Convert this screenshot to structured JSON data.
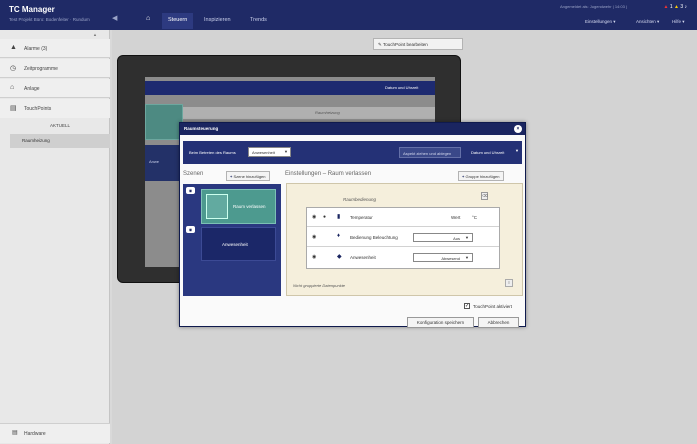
{
  "app": {
    "title": "TC Manager",
    "subtitle": "Test Projekt Büro: Bodenfeiter · Rundum"
  },
  "nav": {
    "tabs": [
      "Steuern",
      "Inspizieren",
      "Trends"
    ],
    "active": "Steuern"
  },
  "topright": {
    "info": "Angemeldet als: Jugendwehr | 14:03 |",
    "badges": [
      "1",
      "3"
    ],
    "menus": [
      "Einstellungen",
      "Ansichten",
      "Hilfe"
    ]
  },
  "sidebar": {
    "items": [
      "Alarme (3)",
      "Zeitprogramme",
      "Anlage",
      "TouchPoints"
    ],
    "sub_header": "AKTUELL",
    "sub_item": "Raumheizung",
    "bottom": "Hardware"
  },
  "main": {
    "edit_button": "TouchPoint bearbeiten"
  },
  "preview": {
    "date": "Datum und Uhrzeit",
    "sub": "Raumheizung",
    "tile": "Anwe"
  },
  "dialog": {
    "title": "Raumsteuerung",
    "bar": {
      "label": "Beim Betreten des Raums",
      "select": "Anwesenheit",
      "button1": "Aspekt ziehen und ablegen",
      "button2": "Datum und Uhrzeit"
    },
    "scenes": {
      "title": "Szenen",
      "add_button": "Szene hinzufügen",
      "items": [
        "Raum verlassen",
        "Anwesenheit"
      ]
    },
    "settings": {
      "title": "Einstellungen",
      "separator": "–",
      "subtitle": "Raum verlassen",
      "add_group_button": "Gruppe hinzufügen",
      "group_label": "Raumbedienung",
      "rows": [
        {
          "label": "Temperatur",
          "value": "Wert",
          "unit": "°C"
        },
        {
          "label": "Bedienung Beleuchtung",
          "value": "Aus"
        },
        {
          "label": "Anwesenheit",
          "value": "Abwesend"
        }
      ],
      "ungrouped": "Nicht gruppierte Datenpunkte"
    },
    "touchpoint_checkbox": "TouchPoint aktiviert",
    "save_button": "Konfiguration speichern",
    "cancel_button": "Abbrechen"
  },
  "colors": {
    "topbar": "#1f2a66",
    "dialog_bar": "#243176",
    "scene_active": "#4d9a8f",
    "settings_bg": "#f5efdc"
  }
}
